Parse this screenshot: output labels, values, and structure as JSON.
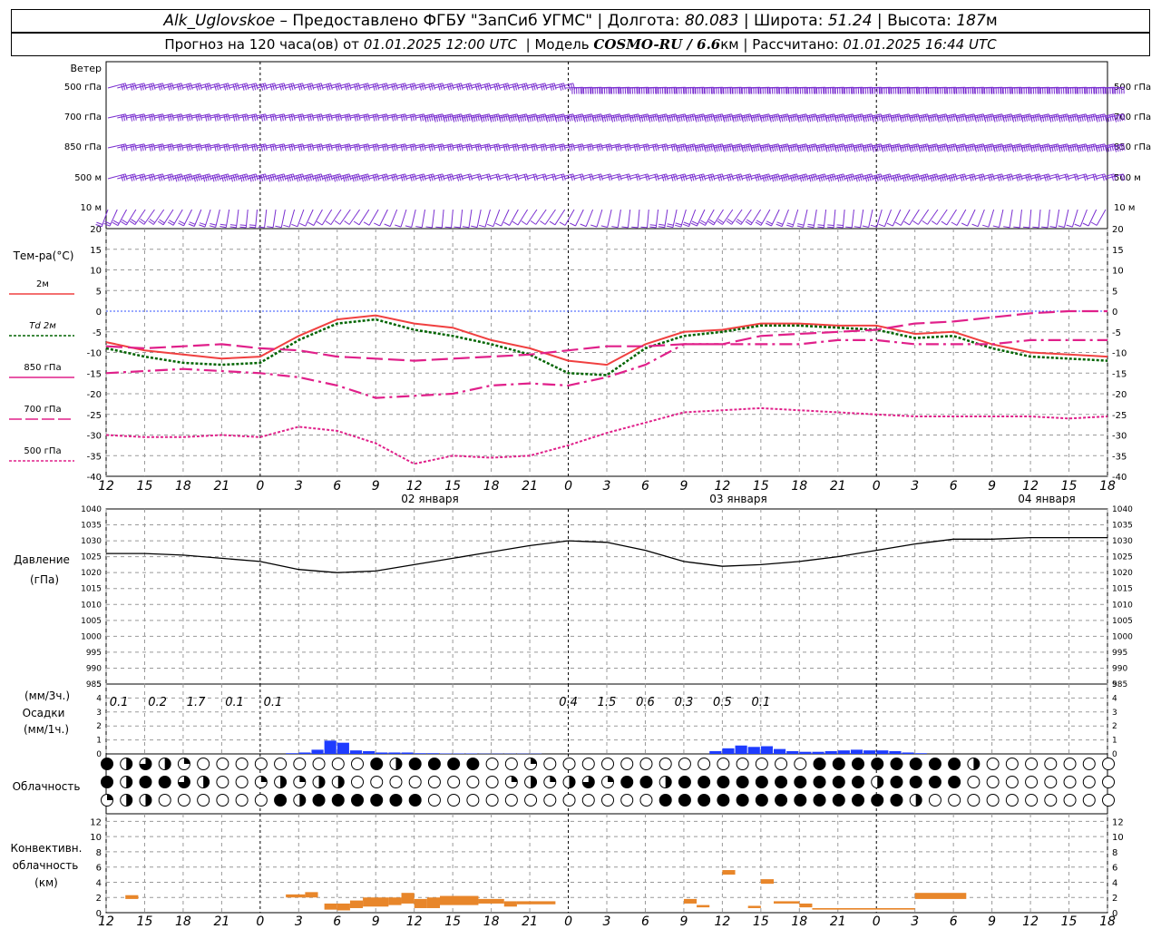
{
  "header": {
    "station": "Alk_Uglovskoe",
    "dash": " – ",
    "provider": "Предоставлено ФГБУ \"ЗапСиб УГМС\"",
    "lon_label": "Долгота:",
    "lon": "80.083",
    "lat_label": "Широта:",
    "lat": "51.24",
    "alt_label": "Высота:",
    "alt": "187",
    "alt_unit": "м",
    "forecast_prefix": "Прогноз на 120 часа(ов) от",
    "forecast_time": "01.01.2025 12:00 UTC",
    "model_label": "Модель",
    "model": "COSMO-RU / 6.6",
    "model_unit": "км",
    "calc_label": "Рассчитано:",
    "calc_time": "01.01.2025 16:44 UTC"
  },
  "wind": {
    "title": "Ветер",
    "levels": [
      "500 гПа",
      "700 гПа",
      "850 гПа",
      "500 м",
      "10 м"
    ]
  },
  "temp": {
    "title": "Тем-ра(°C)",
    "legend": [
      "2м",
      "Td  2м",
      "850 гПа",
      "700 гПа",
      "500 гПа"
    ],
    "legend_colors": [
      "#f04040",
      "#006400",
      "#e0208a",
      "#e0208a",
      "#e0208a"
    ],
    "ticks": [
      "20",
      "15",
      "10",
      "5",
      "0",
      "-5",
      "-10",
      "-15",
      "-20",
      "-25",
      "-30",
      "-35",
      "-40"
    ]
  },
  "time_axis": {
    "hour_labels": [
      "12",
      "15",
      "18",
      "21",
      "0",
      "3",
      "6",
      "9",
      "12",
      "15",
      "18",
      "21",
      "0",
      "3",
      "6",
      "9",
      "12",
      "15",
      "18",
      "21",
      "0",
      "3",
      "6",
      "9",
      "12",
      "15",
      "18"
    ],
    "dates": [
      "02 января",
      "03 января",
      "04 января"
    ]
  },
  "pressure": {
    "title1": "Давление",
    "title2": "(гПа)",
    "ticks": [
      "1040",
      "1035",
      "1030",
      "1025",
      "1020",
      "1015",
      "1010",
      "1005",
      "1000",
      "995",
      "990",
      "985"
    ]
  },
  "precip": {
    "title1": "(мм/3ч.)",
    "title2": "Осадки",
    "title3": "(мм/1ч.)",
    "ticks": [
      "5",
      "4",
      "3",
      "2",
      "1",
      "0"
    ],
    "labels_3h": [
      "0.1",
      "0.2",
      "1.7",
      "0.1",
      "0.1",
      "0.4",
      "1.5",
      "0.6",
      "0.3",
      "0.5",
      "0.1"
    ],
    "color": "#1e3cff"
  },
  "clouds": {
    "title": "Облачность"
  },
  "convective": {
    "title1": "Конвективн.",
    "title2": "облачность",
    "title3": "(км)",
    "ticks": [
      "12",
      "10",
      "8",
      "6",
      "4",
      "2",
      "0"
    ],
    "color": "#e8862a"
  },
  "chart_data": [
    {
      "type": "line",
      "title": "Тем-ра(°C)",
      "x_hours": [
        0,
        3,
        6,
        9,
        12,
        15,
        18,
        21,
        24,
        27,
        30,
        33,
        36,
        39,
        42,
        45,
        48,
        51,
        54,
        57,
        60,
        63,
        66,
        69,
        72,
        75,
        78
      ],
      "ylim": [
        -40,
        20
      ],
      "series": [
        {
          "name": "2м",
          "values": [
            -7.5,
            -9.5,
            -10.5,
            -11.5,
            -11,
            -6,
            -2,
            -1,
            -3,
            -4,
            -7,
            -9,
            -12,
            -13,
            -8,
            -5,
            -4.5,
            -3,
            -3,
            -3.5,
            -3.5,
            -5.5,
            -5,
            -8,
            -10,
            -10.5,
            -11
          ]
        },
        {
          "name": "Td  2м",
          "values": [
            -9,
            -11,
            -12.5,
            -13,
            -12.5,
            -7,
            -3,
            -2,
            -4.5,
            -6,
            -8,
            -10.5,
            -15,
            -15.5,
            -9,
            -6,
            -5,
            -3.5,
            -3.5,
            -4,
            -4.5,
            -6.5,
            -6,
            -9,
            -11,
            -11.5,
            -12
          ]
        },
        {
          "name": "850 гПа",
          "values": [
            -8.5,
            -9,
            -8.5,
            -8,
            -9,
            -9.5,
            -11,
            -11.5,
            -12,
            -11.5,
            -11,
            -10.5,
            -9.5,
            -8.5,
            -8.5,
            -8,
            -8,
            -6,
            -5.5,
            -5,
            -4.5,
            -3,
            -2.5,
            -1.5,
            -0.5,
            0,
            0
          ]
        },
        {
          "name": "700 гПа",
          "values": [
            -15,
            -14.5,
            -14,
            -14.5,
            -15,
            -16,
            -18,
            -21,
            -20.5,
            -20,
            -18,
            -17.5,
            -18,
            -16,
            -13,
            -8,
            -8,
            -8,
            -8,
            -7,
            -7,
            -8,
            -8,
            -8,
            -7,
            -7,
            -7
          ]
        },
        {
          "name": "500 гПа",
          "values": [
            -30,
            -30.5,
            -30.5,
            -30,
            -30.5,
            -28,
            -29,
            -32,
            -37,
            -35,
            -35.5,
            -35,
            -32.5,
            -29.5,
            -27,
            -24.5,
            -24,
            -23.5,
            -24,
            -24.5,
            -25,
            -25.5,
            -25.5,
            -25.5,
            -25.5,
            -26,
            -25.5
          ]
        }
      ]
    },
    {
      "type": "line",
      "title": "Давление (гПа)",
      "x_hours": [
        0,
        3,
        6,
        9,
        12,
        15,
        18,
        21,
        24,
        27,
        30,
        33,
        36,
        39,
        42,
        45,
        48,
        51,
        54,
        57,
        60,
        63,
        66,
        69,
        72,
        75,
        78
      ],
      "ylim": [
        985,
        1040
      ],
      "series": [
        {
          "name": "",
          "values": [
            1026,
            1026,
            1025.5,
            1024.5,
            1023.5,
            1021,
            1020,
            1020.5,
            1022.5,
            1024.5,
            1026.5,
            1028.5,
            1030,
            1029.5,
            1027,
            1023.5,
            1022,
            1022.5,
            1023.5,
            1025,
            1027,
            1029,
            1030.5,
            1030.5,
            1031,
            1031,
            1031
          ]
        }
      ]
    },
    {
      "type": "bar",
      "title": "Осадки (мм/1ч.)",
      "x_hours": [
        14,
        15,
        16,
        17,
        18,
        19,
        20,
        21,
        22,
        23,
        24,
        25,
        26,
        27,
        28,
        29,
        30,
        31,
        32,
        33,
        47,
        48,
        49,
        50,
        51,
        52,
        53,
        54,
        55,
        56,
        57,
        58,
        59,
        60,
        61,
        62,
        63
      ],
      "values": [
        0.05,
        0.1,
        0.3,
        0.95,
        0.8,
        0.25,
        0.2,
        0.1,
        0.1,
        0.1,
        0.05,
        0.05,
        0.03,
        0.03,
        0.03,
        0.02,
        0.02,
        0.02,
        0.02,
        0.02,
        0.2,
        0.4,
        0.6,
        0.5,
        0.55,
        0.35,
        0.2,
        0.15,
        0.15,
        0.2,
        0.25,
        0.3,
        0.25,
        0.25,
        0.2,
        0.1,
        0.05
      ],
      "ylim": [
        0,
        5
      ]
    },
    {
      "type": "bar",
      "title": "Конвективн. облачность (км)",
      "segments": [
        {
          "start_h": 1.5,
          "end_h": 2.5,
          "base": 1.8,
          "top": 2.3
        },
        {
          "start_h": 14,
          "end_h": 15.5,
          "base": 2.0,
          "top": 2.4
        },
        {
          "start_h": 15.5,
          "end_h": 16.5,
          "base": 2.0,
          "top": 2.7
        },
        {
          "start_h": 17,
          "end_h": 18,
          "base": 0.4,
          "top": 1.2
        },
        {
          "start_h": 18,
          "end_h": 19,
          "base": 0.3,
          "top": 1.2
        },
        {
          "start_h": 19,
          "end_h": 20,
          "base": 0.6,
          "top": 1.6
        },
        {
          "start_h": 20,
          "end_h": 22,
          "base": 0.8,
          "top": 2.0
        },
        {
          "start_h": 22,
          "end_h": 23,
          "base": 1.0,
          "top": 2.0
        },
        {
          "start_h": 23,
          "end_h": 24,
          "base": 1.2,
          "top": 2.6
        },
        {
          "start_h": 24,
          "end_h": 25,
          "base": 0.6,
          "top": 1.8
        },
        {
          "start_h": 25,
          "end_h": 26,
          "base": 0.6,
          "top": 2.0
        },
        {
          "start_h": 26,
          "end_h": 29,
          "base": 1.0,
          "top": 2.2
        },
        {
          "start_h": 29,
          "end_h": 31,
          "base": 1.2,
          "top": 1.8
        },
        {
          "start_h": 31,
          "end_h": 32,
          "base": 0.8,
          "top": 1.5
        },
        {
          "start_h": 32,
          "end_h": 35,
          "base": 1.1,
          "top": 1.5
        },
        {
          "start_h": 45,
          "end_h": 46,
          "base": 1.2,
          "top": 1.8
        },
        {
          "start_h": 46,
          "end_h": 47,
          "base": 0.7,
          "top": 1.0
        },
        {
          "start_h": 48,
          "end_h": 49,
          "base": 5.0,
          "top": 5.6
        },
        {
          "start_h": 50,
          "end_h": 51,
          "base": 0.6,
          "top": 0.9
        },
        {
          "start_h": 51,
          "end_h": 52,
          "base": 3.8,
          "top": 4.4
        },
        {
          "start_h": 52,
          "end_h": 54,
          "base": 1.2,
          "top": 1.5
        },
        {
          "start_h": 54,
          "end_h": 55,
          "base": 0.7,
          "top": 1.2
        },
        {
          "start_h": 55,
          "end_h": 60,
          "base": 0.4,
          "top": 0.6
        },
        {
          "start_h": 60,
          "end_h": 63,
          "base": 0.4,
          "top": 0.6
        },
        {
          "start_h": 63,
          "end_h": 67,
          "base": 1.8,
          "top": 2.6
        }
      ],
      "ylim": [
        0,
        13
      ]
    }
  ]
}
